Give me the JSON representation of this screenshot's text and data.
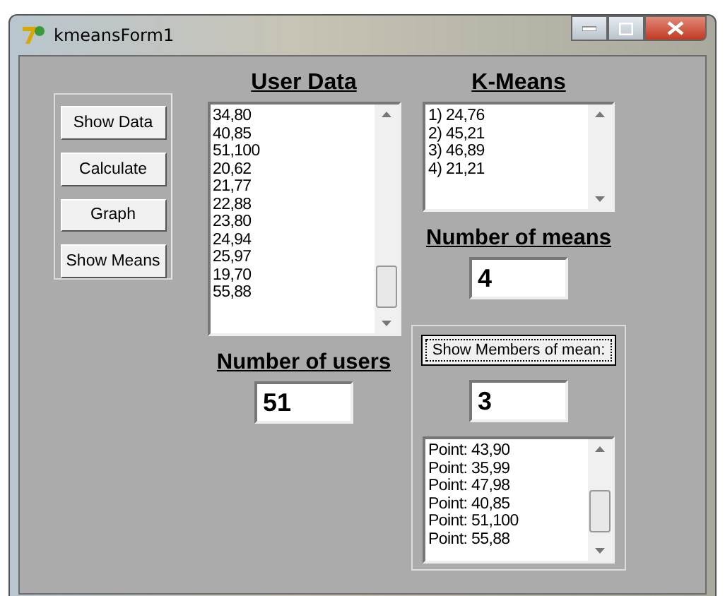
{
  "window": {
    "title": "kmeansForm1"
  },
  "buttons": [
    "Show Data",
    "Calculate",
    "Graph",
    "Show Means"
  ],
  "user_data": {
    "title": "User Data",
    "items": [
      "34,80",
      "40,85",
      "51,100",
      "20,62",
      "21,77",
      "22,88",
      "23,80",
      "24,94",
      "25,97",
      "19,70",
      "55,88"
    ]
  },
  "number_of_users": {
    "label": "Number of users",
    "value": "51"
  },
  "k_means": {
    "title": "K-Means",
    "items": [
      "1) 24,76",
      "2) 45,21",
      "3) 46,89",
      "4) 21,21"
    ]
  },
  "number_of_means": {
    "label": "Number of means",
    "value": "4"
  },
  "members": {
    "button": "Show Members of mean:",
    "value": "3",
    "items": [
      "Point: 43,90",
      "Point: 35,99",
      "Point: 47,98",
      "Point: 40,85",
      "Point: 51,100",
      "Point: 55,88"
    ]
  }
}
